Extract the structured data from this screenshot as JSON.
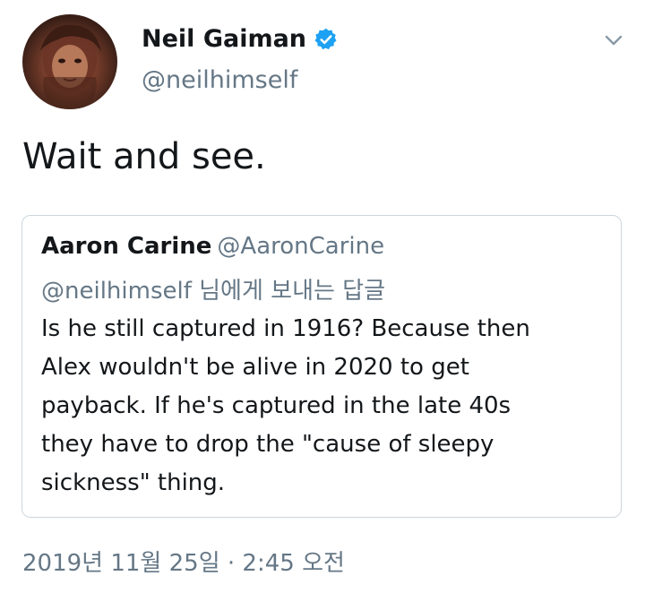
{
  "author": {
    "name": "Neil Gaiman",
    "handle": "@neilhimself",
    "verified": true,
    "avatar_icon": "profile-photo"
  },
  "menu_icon": "chevron-down-icon",
  "tweet": {
    "text": "Wait and see."
  },
  "quoted_tweet": {
    "name": "Aaron Carine",
    "handle": "@AaronCarine",
    "reply_to": "@neilhimself 님에게 보내는 답글",
    "body_lines": [
      "Is he still captured in 1916? Because then",
      "Alex wouldn't be alive in 2020 to get",
      "payback. If he's captured in the late 40s",
      "they have to drop the \"cause of sleepy",
      "sickness\" thing."
    ]
  },
  "timestamp": "2019년 11월 25일 · 2:45 오전",
  "colors": {
    "text_primary": "#14171a",
    "text_secondary": "#657786",
    "verified_blue": "#1da1f2",
    "border": "#ccd6dd"
  }
}
